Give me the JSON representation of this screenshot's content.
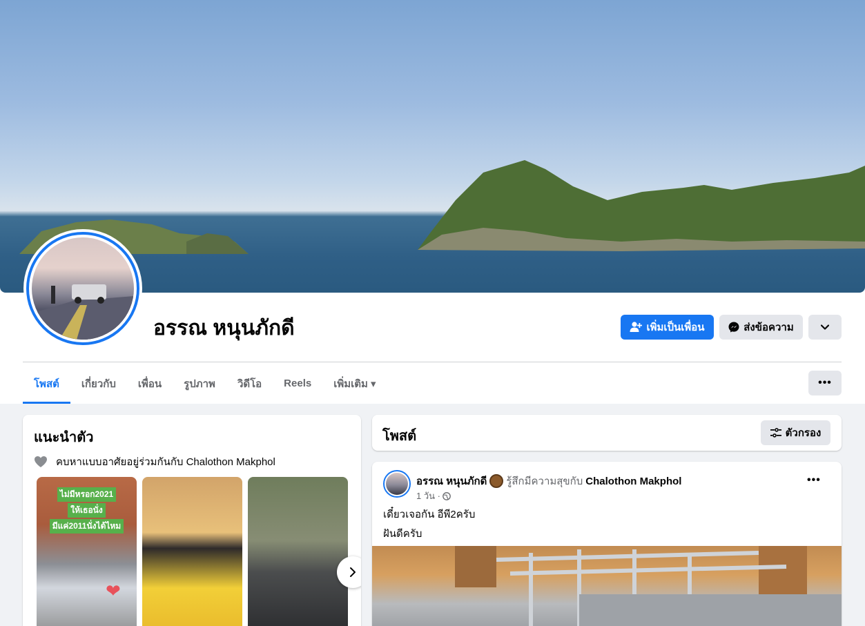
{
  "profile": {
    "name": "อรรณ หนุนภักดี",
    "add_friend_label": "เพิ่มเป็นเพื่อน",
    "message_label": "ส่งข้อความ"
  },
  "tabs": [
    {
      "label": "โพสต์",
      "active": true
    },
    {
      "label": "เกี่ยวกับ"
    },
    {
      "label": "เพื่อน"
    },
    {
      "label": "รูปภาพ"
    },
    {
      "label": "วิดีโอ"
    },
    {
      "label": "Reels"
    },
    {
      "label": "เพิ่มเติม ▾"
    }
  ],
  "intro": {
    "title": "แนะนำตัว",
    "relationship": "คบหาแบบอาศัยอยู่ร่วมกันกับ Chalothon Makphol",
    "photo1_lines": [
      "ไม่มีหรอก2021",
      "ให้เธอนั่ง",
      "มีแค่2011นั่งได้ไหม"
    ]
  },
  "posts_section": {
    "title": "โพสต์",
    "filter_label": "ตัวกรอง"
  },
  "post": {
    "author": "อรรณ หนุนภักดี",
    "feeling": "รู้สึกมีความสุขกับ",
    "tagged": "Chalothon Makphol",
    "time": "1 วัน ·",
    "line1": "เดี๋ยวเจอกัน  อีพี2ครับ",
    "line2": "ฝันดีครับ"
  },
  "colors": {
    "accent": "#1877f2",
    "button_grey": "#e4e6eb",
    "page_bg": "#f0f2f5"
  }
}
